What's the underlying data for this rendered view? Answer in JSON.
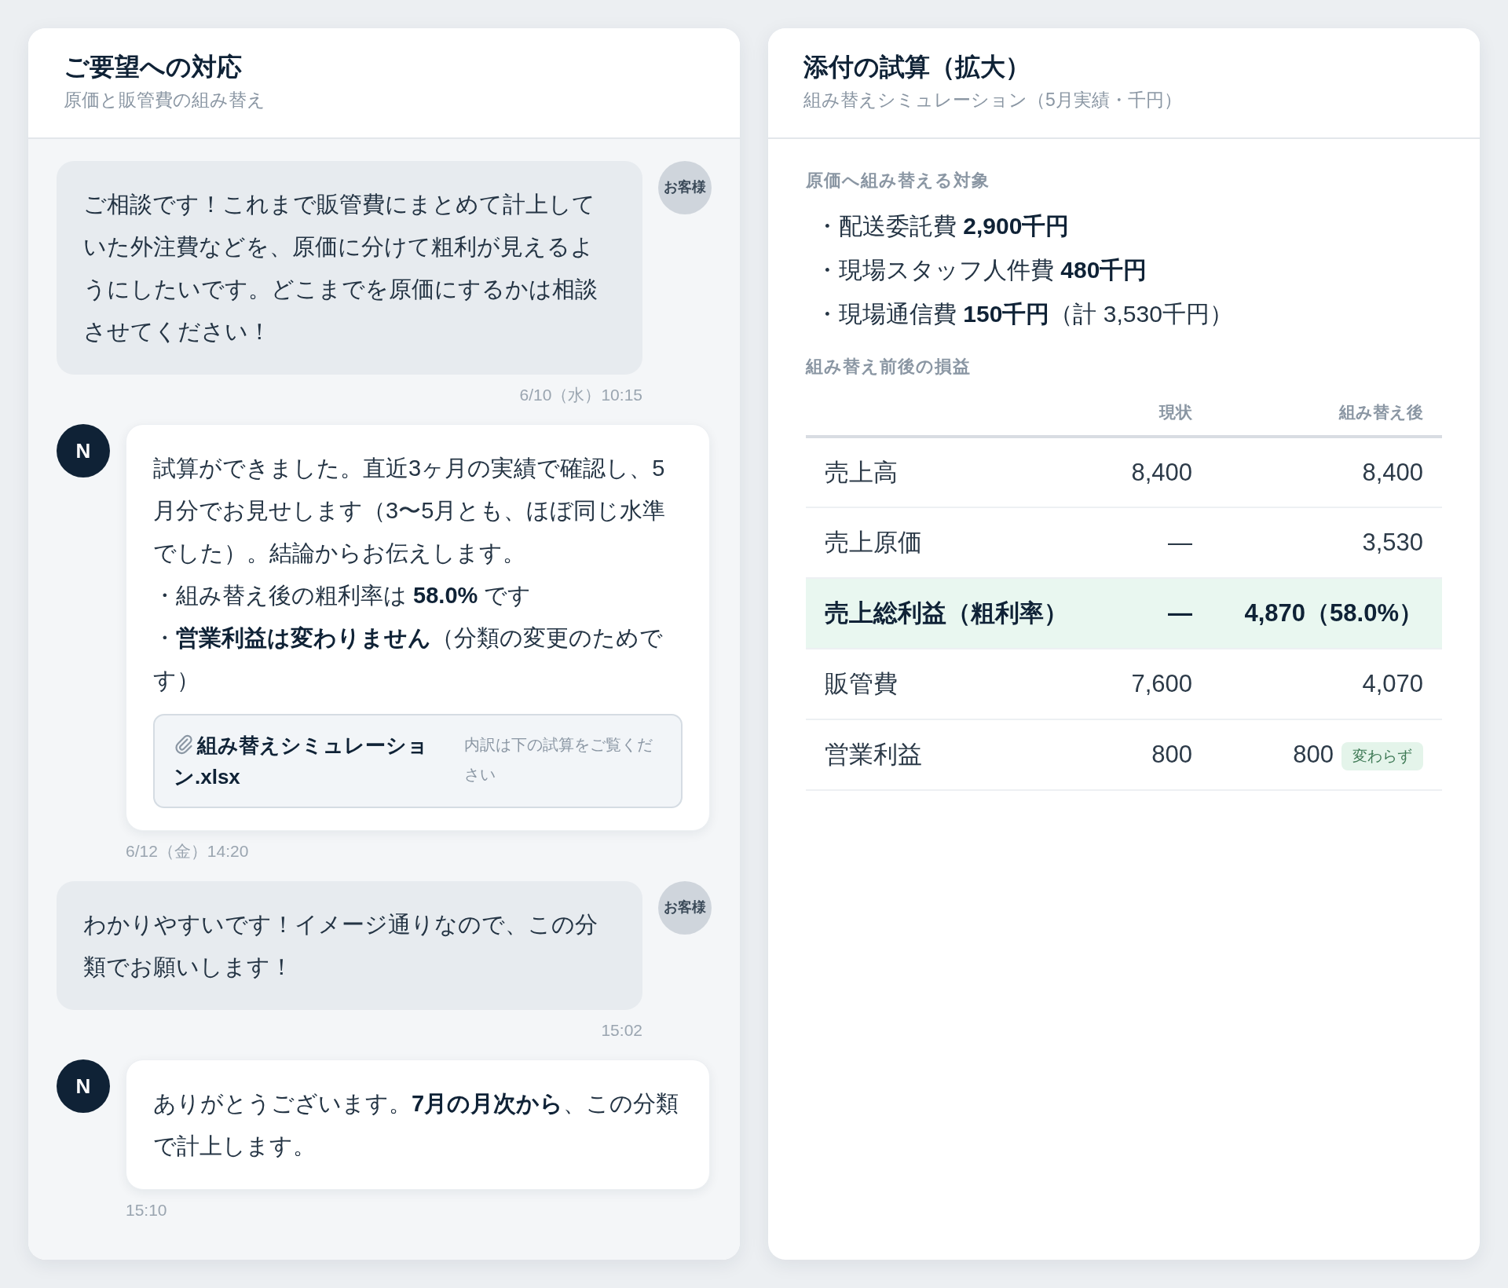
{
  "chat": {
    "title": "ご要望への対応",
    "subtitle": "原価と販管費の組み替え",
    "messages": [
      {
        "kind": "customer",
        "avatar": "お客様",
        "lines": [
          "ご相談です！これまで販管費にまとめて計上していた外注費などを、原価に分けて粗利が見えるようにしたいです。どこまでを原価にするかは相談させてください！"
        ],
        "time": "6/10（水）10:15"
      },
      {
        "kind": "agent",
        "avatar": "N",
        "lines": [
          "試算ができました。直近3ヶ月の実績で確認し、5月分でお見せします（3〜5月とも、ほぼ同じ水準でした）。結論からお伝えします。",
          "・組み替え後の粗利率は **58.0%** です",
          "・**営業利益は変わりません**（分類の変更のためです）"
        ],
        "attachment": {
          "name": "組み替えシミュレーション.xlsx",
          "note": "内訳は下の試算をご覧ください"
        },
        "time": "6/12（金）14:20"
      },
      {
        "kind": "customer",
        "avatar": "お客様",
        "lines": [
          "わかりやすいです！イメージ通りなので、この分類でお願いします！"
        ],
        "time": "15:02"
      },
      {
        "kind": "agent",
        "avatar": "N",
        "lines": [
          "ありがとうございます。**7月の月次から**、この分類で計上します。"
        ],
        "time": "15:10"
      }
    ]
  },
  "preview": {
    "title": "添付の試算（拡大）",
    "subtitle": "組み替えシミュレーション（5月実績・千円）",
    "targets_heading": "原価へ組み替える対象",
    "targets": [
      "・配送委託費 **2,900千円**",
      "・現場スタッフ人件費 **480千円**",
      "・現場通信費 **150千円**（計 3,530千円）"
    ],
    "table_heading": "組み替え前後の損益",
    "table": {
      "columns": [
        "現状",
        "組み替え後"
      ],
      "rows": [
        {
          "label": "売上高",
          "current": "8,400",
          "after": "8,400",
          "highlighted": false
        },
        {
          "label": "売上原価",
          "current": "—",
          "after": "3,530",
          "highlighted": false
        },
        {
          "label": "売上総利益（粗利率）",
          "current": "—",
          "after": "4,870（58.0%）",
          "highlighted": true
        },
        {
          "label": "販管費",
          "current": "7,600",
          "after": "4,070",
          "highlighted": false
        },
        {
          "label": "営業利益",
          "current": "800",
          "after": "800",
          "badge": "変わらず",
          "highlighted": false
        }
      ]
    }
  }
}
